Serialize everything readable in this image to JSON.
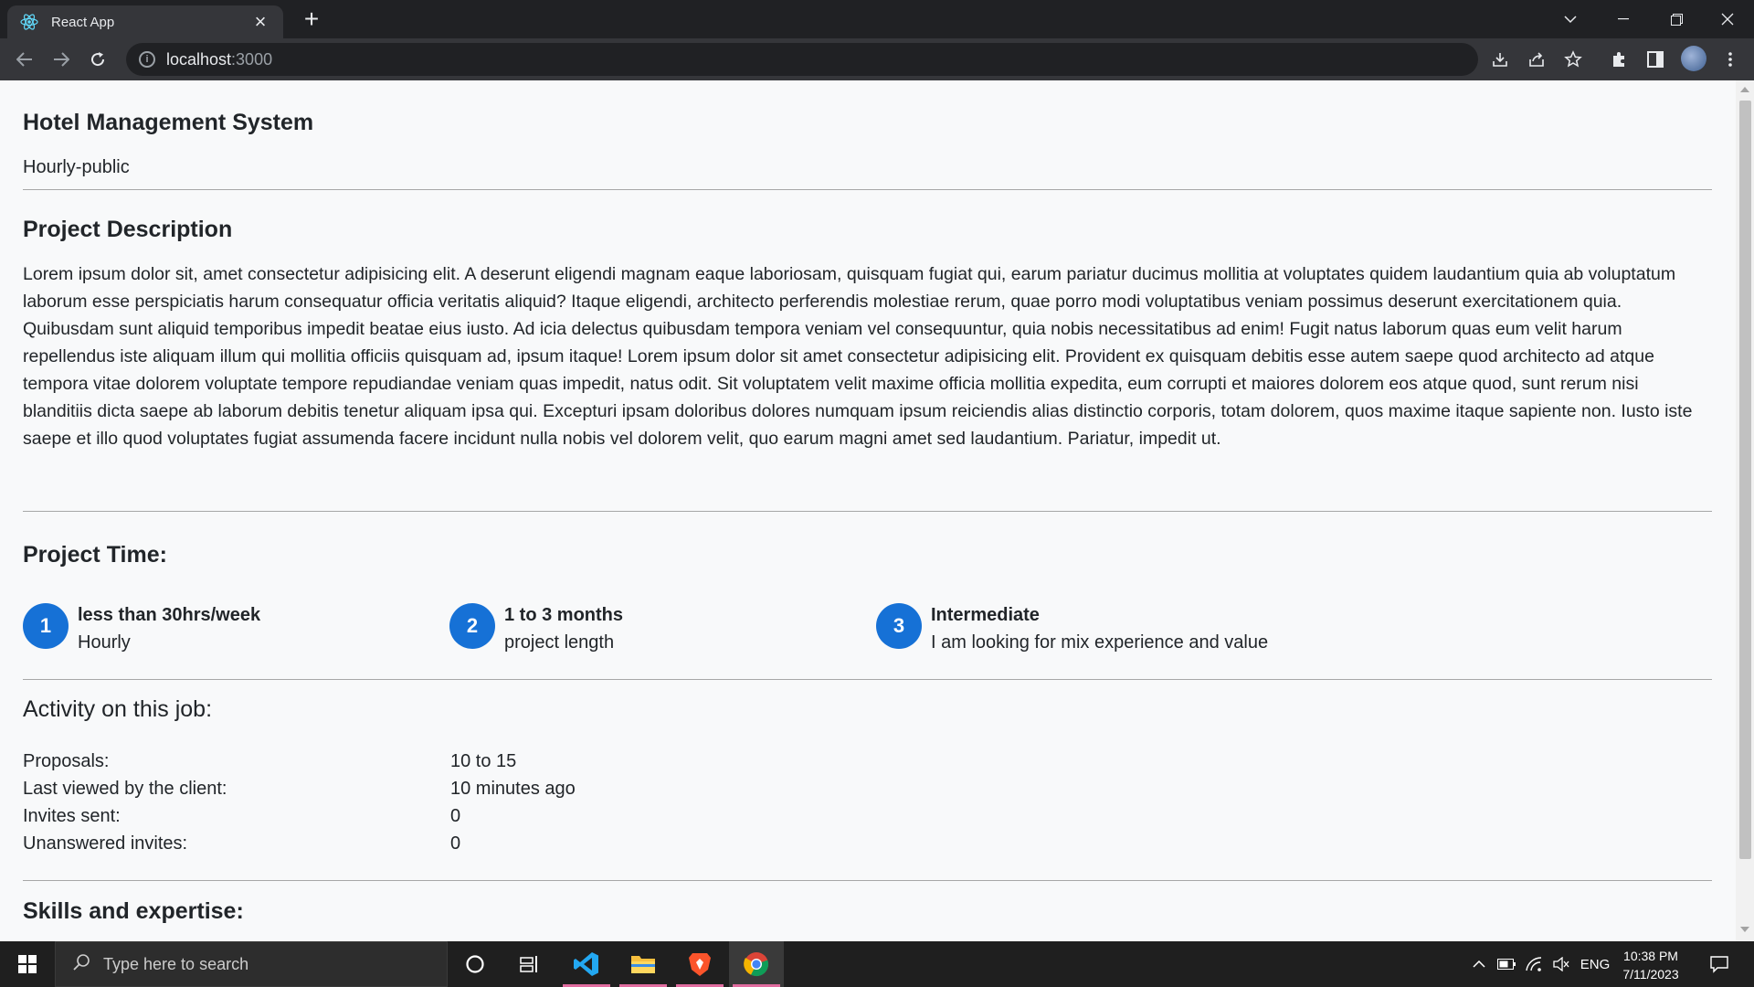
{
  "browser": {
    "tab_title": "React App",
    "url_host": "localhost",
    "url_port": ":3000",
    "accent": "#1671d6"
  },
  "header": {
    "title": "Hotel Management System",
    "subtitle": "Hourly-public"
  },
  "description": {
    "heading": "Project Description",
    "text": "Lorem ipsum dolor sit, amet consectetur adipisicing elit. A deserunt eligendi magnam eaque laboriosam, quisquam fugiat qui, earum pariatur ducimus mollitia at voluptates quidem laudantium quia ab voluptatum laborum esse perspiciatis harum consequatur officia veritatis aliquid? Itaque eligendi, architecto perferendis molestiae rerum, quae porro modi voluptatibus veniam possimus deserunt exercitationem quia. Quibusdam sunt aliquid temporibus impedit beatae eius iusto. Ad icia delectus quibusdam tempora veniam vel consequuntur, quia nobis necessitatibus ad enim! Fugit natus laborum quas eum velit harum repellendus iste aliquam illum qui mollitia officiis quisquam ad, ipsum itaque! Lorem ipsum dolor sit amet consectetur adipisicing elit. Provident ex quisquam debitis esse autem saepe quod architecto ad atque tempora vitae dolorem voluptate tempore repudiandae veniam quas impedit, natus odit. Sit voluptatem velit maxime officia mollitia expedita, eum corrupti et maiores dolorem eos atque quod, sunt rerum nisi blanditiis dicta saepe ab laborum debitis tenetur aliquam ipsa qui. Excepturi ipsam doloribus dolores numquam ipsum reiciendis alias distinctio corporis, totam dolorem, quos maxime itaque sapiente non. Iusto iste saepe et illo quod voluptates fugiat assumenda facere incidunt nulla nobis vel dolorem velit, quo earum magni amet sed laudantium. Pariatur, impedit ut."
  },
  "project_time": {
    "heading": "Project Time:",
    "items": [
      {
        "number": "1",
        "title": "less than 30hrs/week",
        "subtitle": "Hourly"
      },
      {
        "number": "2",
        "title": "1 to 3 months",
        "subtitle": "project length"
      },
      {
        "number": "3",
        "title": "Intermediate",
        "subtitle": "I am looking for mix experience and value"
      }
    ]
  },
  "activity": {
    "heading": "Activity on this job:",
    "rows": [
      {
        "label": "Proposals:",
        "value": "10 to 15"
      },
      {
        "label": "Last viewed by the client:",
        "value": "10 minutes ago"
      },
      {
        "label": "Invites sent:",
        "value": "0"
      },
      {
        "label": "Unanswered invites:",
        "value": "0"
      }
    ]
  },
  "skills": {
    "heading": "Skills and expertise:"
  },
  "taskbar": {
    "search_placeholder": "Type here to search",
    "language": "ENG",
    "time": "10:38 PM",
    "date": "7/11/2023"
  }
}
